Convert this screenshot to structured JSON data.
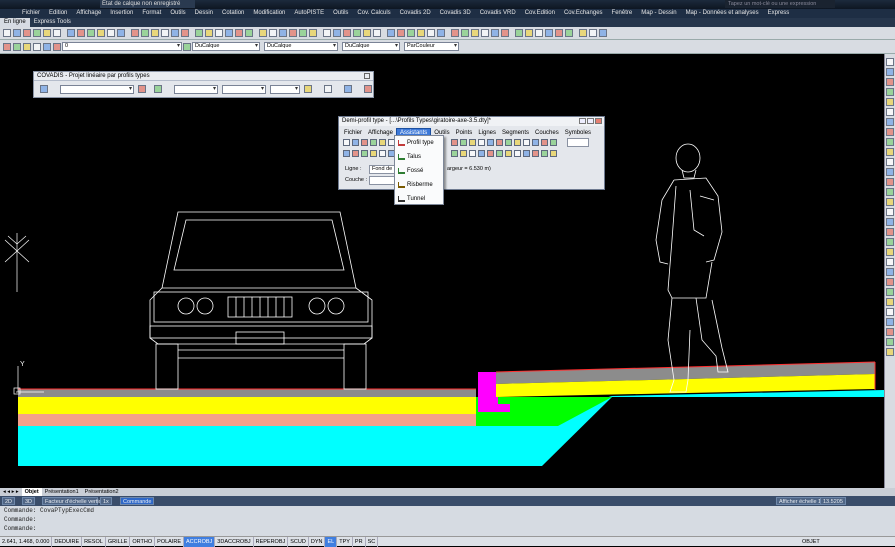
{
  "window": {
    "title_input": "État de calque non enregistré",
    "search_placeholder": "Tapez un mot-clé ou une expression"
  },
  "menubar": [
    "Fichier",
    "Edition",
    "Affichage",
    "Insertion",
    "Format",
    "Outils",
    "Dessin",
    "Cotation",
    "Modification",
    "AutoPISTE",
    "Outils",
    "Cov. Calculs",
    "Covadis 2D",
    "Covadis 3D",
    "Covadis VRD",
    "Cov.Edition",
    "Cov.Echanges",
    "Fenêtre",
    "Map - Dessin",
    "Map - Données et analyses",
    "Express"
  ],
  "ribbon_tabs": [
    {
      "label": "En ligne",
      "active": true
    },
    {
      "label": "Express Tools",
      "active": false
    }
  ],
  "toolbar2": {
    "layer_value": "0",
    "color_value": "DuCalque",
    "linetype_value": "DuCalque",
    "lineweight_value": "DuCalque",
    "plotstyle_value": "ParCouleur"
  },
  "covadis_dialog": {
    "title": "COVADIS - Projet linéaire par profils types"
  },
  "demi_profil": {
    "title": "Demi-profil type - [...\\Profils Types\\giratoire-axe-3.5.dty]*",
    "menu": [
      {
        "label": "Fichier",
        "active": false
      },
      {
        "label": "Affichage",
        "active": false
      },
      {
        "label": "Assistants",
        "active": true
      },
      {
        "label": "Outils",
        "active": false
      },
      {
        "label": "Points",
        "active": false
      },
      {
        "label": "Lignes",
        "active": false
      },
      {
        "label": "Segments",
        "active": false
      },
      {
        "label": "Couches",
        "active": false
      },
      {
        "label": "Symboles",
        "active": false
      }
    ],
    "ligne_label": "Ligne :",
    "ligne_value": "Fond de Fo",
    "largeur_text": "argeur = 6.530 m)",
    "couche_label": "Couche :"
  },
  "assistants_menu": [
    {
      "label": "Profil type",
      "icon": "profil-type-icon",
      "color": "#c23b3b"
    },
    {
      "label": "Talus",
      "icon": "talus-icon",
      "color": "#2e7d32"
    },
    {
      "label": "Fossé",
      "icon": "fosse-icon",
      "color": "#2e7d32"
    },
    {
      "label": "Risberme",
      "icon": "risberme-icon",
      "color": "#7a5a00"
    },
    {
      "label": "Tunnel",
      "icon": "tunnel-icon",
      "color": "#333333"
    }
  ],
  "drawing": {
    "background": "#000000",
    "ucs_y_label": "Y",
    "layers": [
      {
        "name": "surface",
        "color": "#8c8c8c"
      },
      {
        "name": "yellow",
        "color": "#ffff00"
      },
      {
        "name": "salmon",
        "color": "#f4a08a"
      },
      {
        "name": "cyan",
        "color": "#00ffff"
      },
      {
        "name": "green",
        "color": "#00ff00"
      },
      {
        "name": "magenta",
        "color": "#ff00ff"
      }
    ]
  },
  "layout_tabs": [
    {
      "label": "Objet",
      "active": true
    },
    {
      "label": "Présentation1",
      "active": false
    },
    {
      "label": "Présentation2",
      "active": false
    }
  ],
  "status_top": {
    "left_buttons": [
      "2D",
      "3D"
    ],
    "scale_label": "Facteur d'échelle verticale",
    "scale_value": "1x",
    "commande_label": "Commande",
    "right_label": "Afficher échelle 1",
    "right_value": "13.5205"
  },
  "command_lines": [
    "Commande: CovaPTypExecCmd",
    "Commande:",
    "Commande:"
  ],
  "status_bar": {
    "coords": "2.641, 1.468, 0.000",
    "toggles": [
      {
        "label": "DEDUIRE",
        "on": false
      },
      {
        "label": "RESOL",
        "on": false
      },
      {
        "label": "GRILLE",
        "on": false
      },
      {
        "label": "ORTHO",
        "on": false
      },
      {
        "label": "POLAIRE",
        "on": false
      },
      {
        "label": "ACCROBJ",
        "on": true
      },
      {
        "label": "3DACCROBJ",
        "on": false
      },
      {
        "label": "REPEROBJ",
        "on": false
      },
      {
        "label": "SCUD",
        "on": false
      },
      {
        "label": "DYN",
        "on": false
      },
      {
        "label": "EL",
        "on": true
      },
      {
        "label": "TPY",
        "on": false
      },
      {
        "label": "PR",
        "on": false
      },
      {
        "label": "SC",
        "on": false
      }
    ],
    "right_label": "OBJET"
  }
}
